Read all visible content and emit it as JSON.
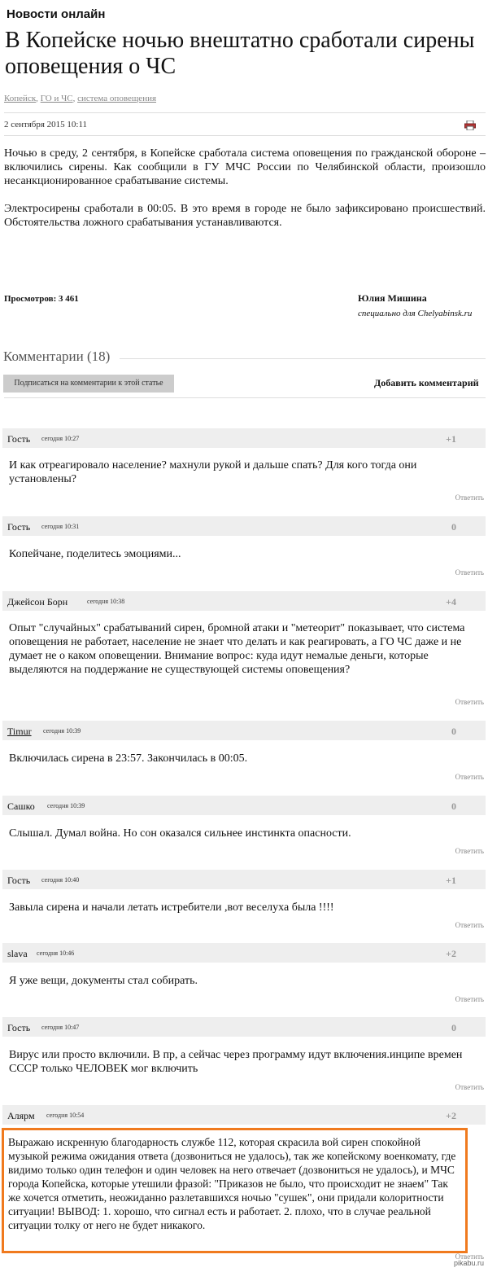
{
  "section": "Новости онлайн",
  "title": "В Копейске ночью внештатно сработали сирены оповещения о ЧС",
  "tags": [
    "Копейск",
    "ГО и ЧС",
    "система оповещения"
  ],
  "tag_sep": ",",
  "date": "2 сентября 2015 10:11",
  "lead": [
    "Ночью в среду, 2 сентября, в Копейске сработала система оповещения по гражданской обороне – включились сирены. Как сообщили в ГУ МЧС России по Челябинской области, произошло несанкционированное срабатывание системы.",
    "Электросирены сработали в 00:05. В это время в городе не было зафиксировано происшествий. Обстоятельства ложного срабатывания устанавливаются."
  ],
  "views": "Просмотров: 3 461",
  "author": "Юлия Мишина",
  "author_sub": "специально для Chelyabinsk.ru",
  "comments_header": "Комментарии (18)",
  "subscribe_label": "Подписаться на комментарии к этой статье",
  "add_comment_label": "Добавить комментарий",
  "reply_label": "Ответить",
  "watermark": "pikabu.ru",
  "comments": [
    {
      "name": "Гость",
      "time": "сегодня 10:27",
      "score": "+1",
      "text": "И как отреагировало население? махнули рукой и дальше спать? Для кого тогда они установлены?"
    },
    {
      "name": "Гость",
      "time": "сегодня 10:31",
      "score": "0",
      "text": "Копейчане, поделитесь эмоциями..."
    },
    {
      "name": "Джейсон Борн",
      "time": "сегодня 10:38",
      "score": "+4",
      "text": "Опыт \"случайных\" срабатываний сирен, бромной атаки и \"метеорит\" показывает, что система оповещения не работает, население не знает что делать и как реагировать, а ГО ЧС даже и не думает не о каком оповещении. Внимание вопрос: куда идут немалые деньги, которые выделяются на поддержание не существующей системы оповещения?"
    },
    {
      "name": "Timur",
      "time": "сегодня 10:39",
      "score": "0",
      "text": "Включилась сирена в 23:57. Закончилась в 00:05."
    },
    {
      "name": "Сашко",
      "time": "сегодня 10:39",
      "score": "0",
      "text": "Слышал. Думал война. Но сон оказался сильнее инстинкта опасности."
    },
    {
      "name": "Гость",
      "time": "сегодня 10:40",
      "score": "+1",
      "text": "Завыла сирена и начали летать истребители ,вот веселуха была !!!!"
    },
    {
      "name": "slava",
      "time": "сегодня 10:46",
      "score": "+2",
      "text": "Я уже вещи, документы стал собирать."
    },
    {
      "name": "Гость",
      "time": "сегодня 10:47",
      "score": "0",
      "text": "Вирус или просто включили. В пр, а сейчас через программу идут включения.инципе времен СССР только ЧЕЛОВЕК мог включить"
    },
    {
      "name": "Алярм",
      "time": "сегодня 10:54",
      "score": "+2",
      "text": "Выражаю искренную благодарность службе 112, которая скрасила вой сирен спокойной музыкой режима ожидания ответа (дозвониться не удалось), так же копейскому военкомату, где видимо только один телефон и один человек на него отвечает (дозвониться не удалось), и МЧС города Копейска, которые утешили фразой: \"Приказов не было, что происходит не знаем\" Так же хочется отметить, неожиданно разлетавшихся ночью \"сушек\", они придали колоритности ситуации! ВЫВОД: 1. хорошо, что сигнал есть и работает. 2. плохо, что в случае реальной ситуации толку от него не будет никакого."
    }
  ],
  "colors": {
    "highlight": "#f07a1e",
    "header_bg": "#eeeeee",
    "button_bg": "#cccccc"
  }
}
